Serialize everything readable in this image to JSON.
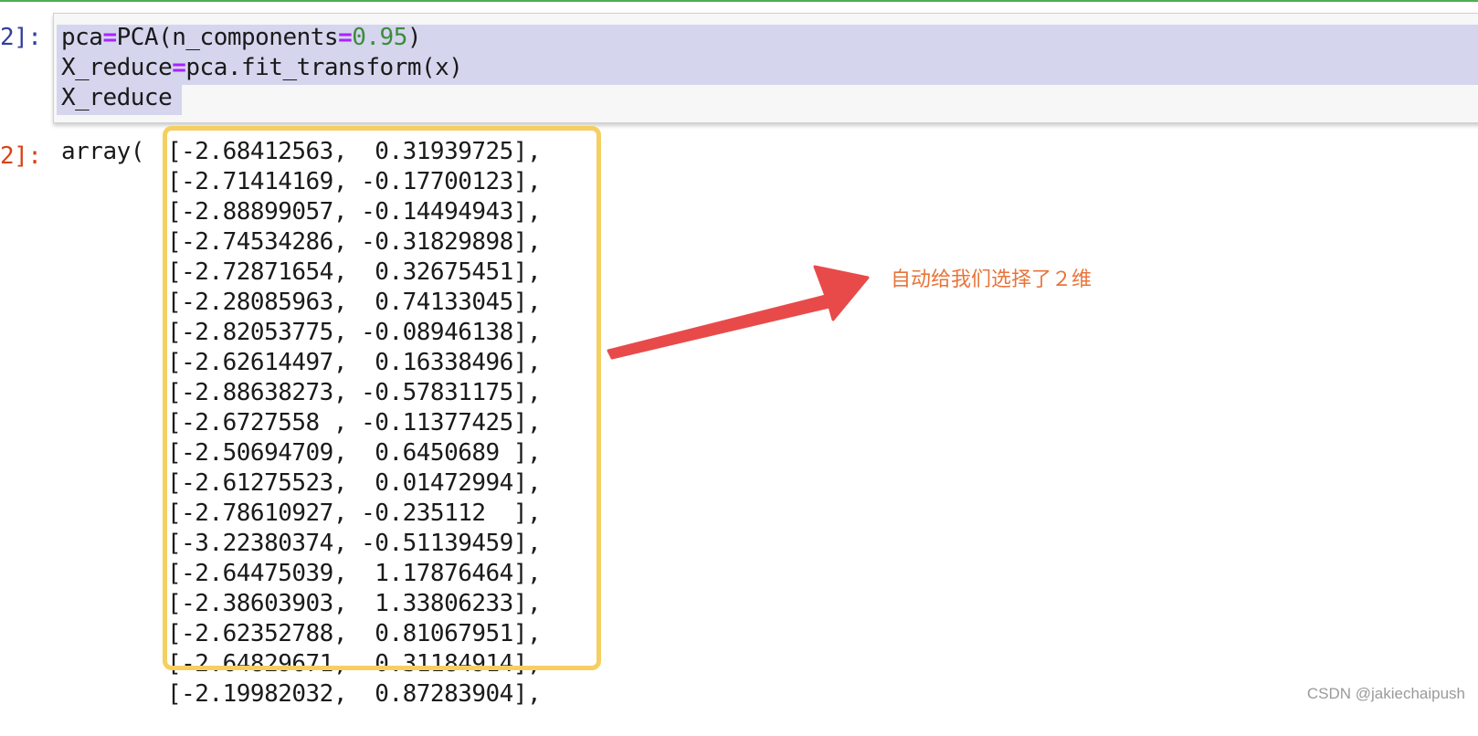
{
  "notebook": {
    "in_prompt": "2]:",
    "out_prompt": "2]:",
    "code": {
      "line1": {
        "a": "pca",
        "op1": "=",
        "b": "PCA(n_components",
        "op2": "=",
        "num": "0.95",
        "c": ")"
      },
      "line2": {
        "a": "X_reduce",
        "op1": "=",
        "b": "pca.fit_transform(x)"
      },
      "line3": "X_reduce"
    },
    "output": {
      "prefix": "array(",
      "rows": [
        "[-2.68412563,  0.31939725],",
        "[-2.71414169, -0.17700123],",
        "[-2.88899057, -0.14494943],",
        "[-2.74534286, -0.31829898],",
        "[-2.72871654,  0.32675451],",
        "[-2.28085963,  0.74133045],",
        "[-2.82053775, -0.08946138],",
        "[-2.62614497,  0.16338496],",
        "[-2.88638273, -0.57831175],",
        "[-2.6727558 , -0.11377425],",
        "[-2.50694709,  0.6450689 ],",
        "[-2.61275523,  0.01472994],",
        "[-2.78610927, -0.235112  ],",
        "[-3.22380374, -0.51139459],",
        "[-2.64475039,  1.17876464],",
        "[-2.38603903,  1.33806233],",
        "[-2.62352788,  0.81067951],",
        "[-2.64829671,  0.31184914],",
        "[-2.19982032,  0.87283904],"
      ]
    }
  },
  "annotation": {
    "text": "自动给我们选择了２维",
    "color": "#e8743a"
  },
  "watermark": "CSDN @jakiechaipush",
  "colors": {
    "highlight_box": "#f5cf61",
    "arrow": "#e84a4a",
    "selection": "#d5d5ee"
  }
}
